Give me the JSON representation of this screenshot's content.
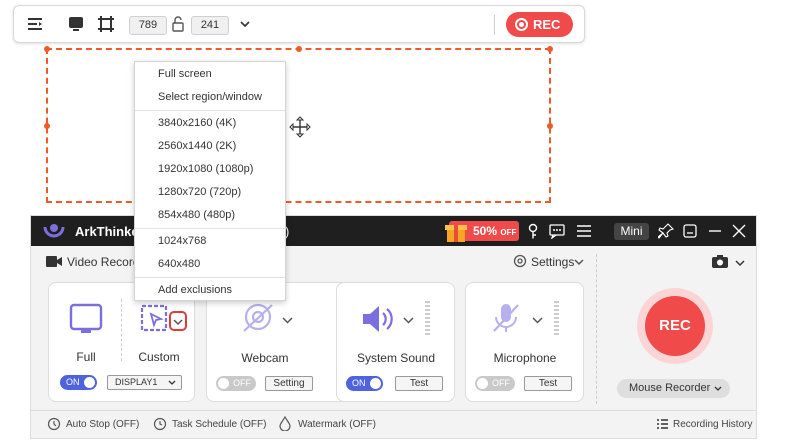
{
  "toolbar": {
    "width_value": "789",
    "height_value": "241",
    "rec_label": "REC"
  },
  "dropdown": {
    "items_top": [
      "Full screen",
      "Select region/window"
    ],
    "resolutions": [
      "3840x2160 (4K)",
      "2560x1440 (2K)",
      "1920x1080 (1080p)",
      "1280x720 (720p)",
      "854x480 (480p)"
    ],
    "extra": [
      "1024x768",
      "640x480"
    ],
    "add_exclusions": "Add exclusions"
  },
  "window": {
    "title": "ArkThinker S",
    "title_suffix": ")",
    "promo": "50%",
    "promo_small": "OFF",
    "mini_label": "Mini",
    "section_title": "Video Recorde",
    "settings_label": "Settings"
  },
  "cards": {
    "full_label": "Full",
    "custom_label": "Custom",
    "display_select": "DISPLAY1",
    "on_label": "ON",
    "off_label": "OFF",
    "webcam_label": "Webcam",
    "setting_button": "Setting",
    "system_sound_label": "System Sound",
    "microphone_label": "Microphone",
    "test_button": "Test"
  },
  "recorder": {
    "rec_label": "REC",
    "mouse_recorder": "Mouse Recorder"
  },
  "bottom": {
    "auto_stop": "Auto Stop (OFF)",
    "task_schedule": "Task Schedule (OFF)",
    "watermark": "Watermark (OFF)",
    "recording_history": "Recording History"
  },
  "colors": {
    "accent_red": "#f04a4a",
    "region_orange": "#f05a28",
    "toggle_blue": "#4f63e0",
    "icon_purple": "#7b6fe0"
  }
}
